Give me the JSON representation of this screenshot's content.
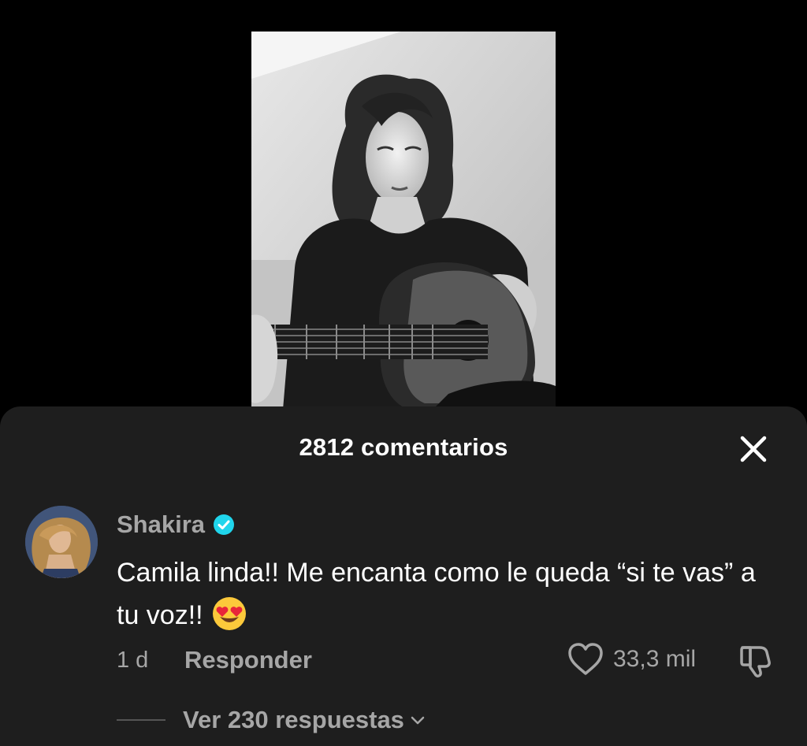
{
  "video": {
    "thumbnail_icon": "woman-playing-guitar-video-frame"
  },
  "comments_sheet": {
    "title": "2812 comentarios",
    "close_icon": "close-icon"
  },
  "comment": {
    "author": "Shakira",
    "verified_icon": "verified-badge-icon",
    "verified_color": "#20d5ec",
    "text": "Camila linda!! Me encanta como le queda “si te vas” a tu voz!!",
    "emoji_icon": "smiling-face-with-heart-eyes-icon",
    "timestamp": "1 d",
    "reply_label": "Responder",
    "like_count": "33,3 mil",
    "like_icon": "heart-outline-icon",
    "dislike_icon": "thumbs-down-icon",
    "view_replies_label": "Ver 230 respuestas",
    "view_replies_icon": "chevron-down-icon"
  },
  "colors": {
    "background": "#000000",
    "sheet_background": "#1e1e1e",
    "secondary_text": "#a6a6a6",
    "primary_text": "#ffffff"
  }
}
